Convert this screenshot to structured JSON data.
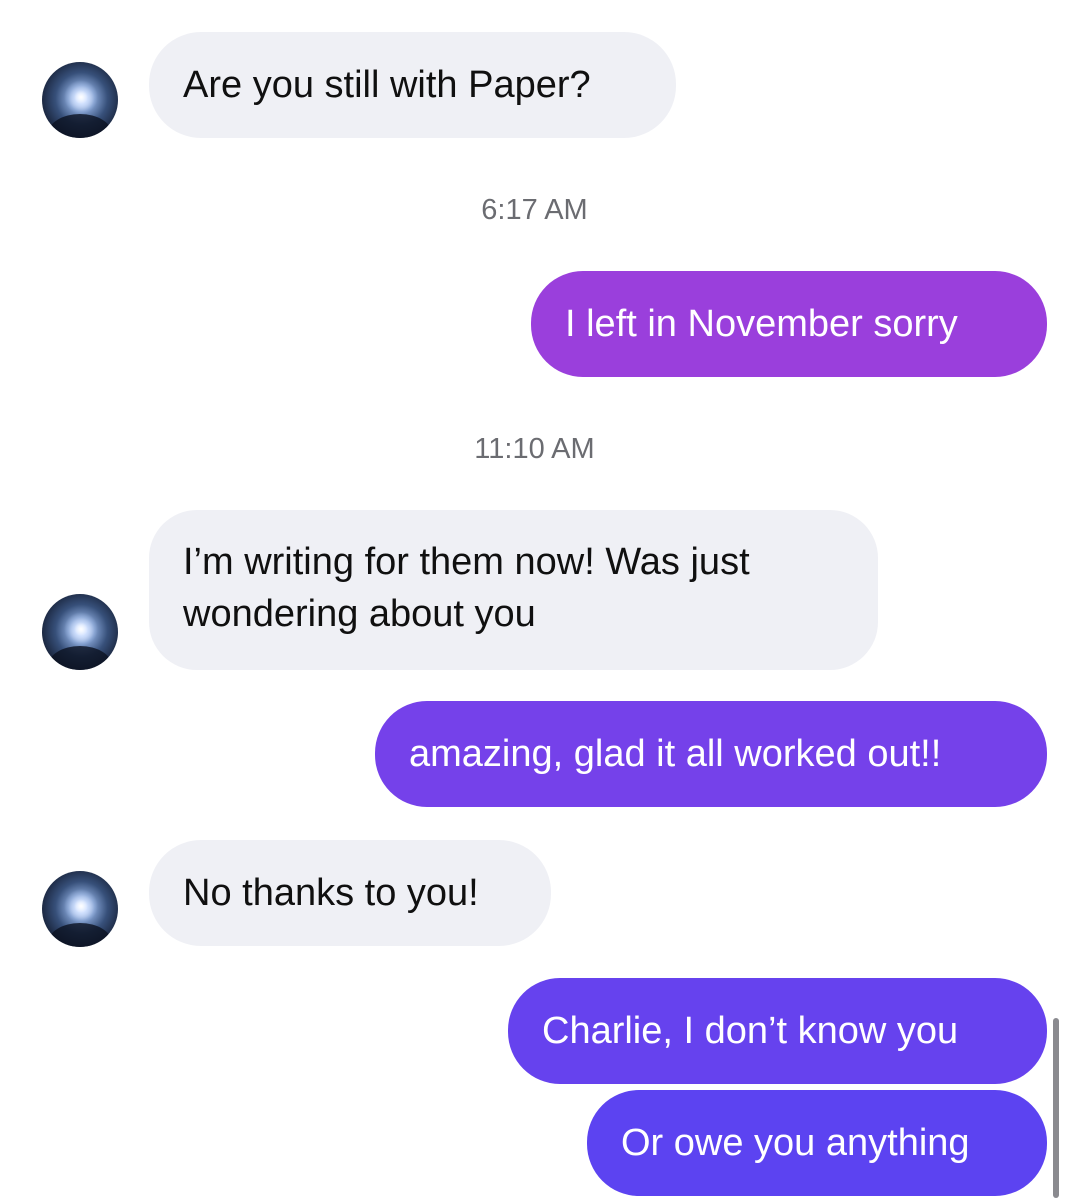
{
  "messages": [
    {
      "id": "m1",
      "direction": "incoming",
      "text": "Are you still with Paper?"
    },
    {
      "id": "m2",
      "direction": "outgoing",
      "text": "I left in November sorry"
    },
    {
      "id": "m3",
      "direction": "incoming",
      "text": "I’m writing for them now! Was just wondering about you"
    },
    {
      "id": "m4",
      "direction": "outgoing",
      "text": "amazing, glad it all worked out!!"
    },
    {
      "id": "m5",
      "direction": "incoming",
      "text": "No thanks to you!"
    },
    {
      "id": "m6",
      "direction": "outgoing",
      "text": "Charlie, I don’t know you"
    },
    {
      "id": "m7",
      "direction": "outgoing",
      "text": "Or owe you anything"
    }
  ],
  "timestamps": [
    "6:17 AM",
    "11:10 AM"
  ],
  "colors": {
    "incoming_bubble": "#eff0f5",
    "outgoing_gradient_top": "#9a3fdc",
    "outgoing_gradient_bottom": "#5c43f1",
    "timestamp_text": "#6b6c71"
  }
}
